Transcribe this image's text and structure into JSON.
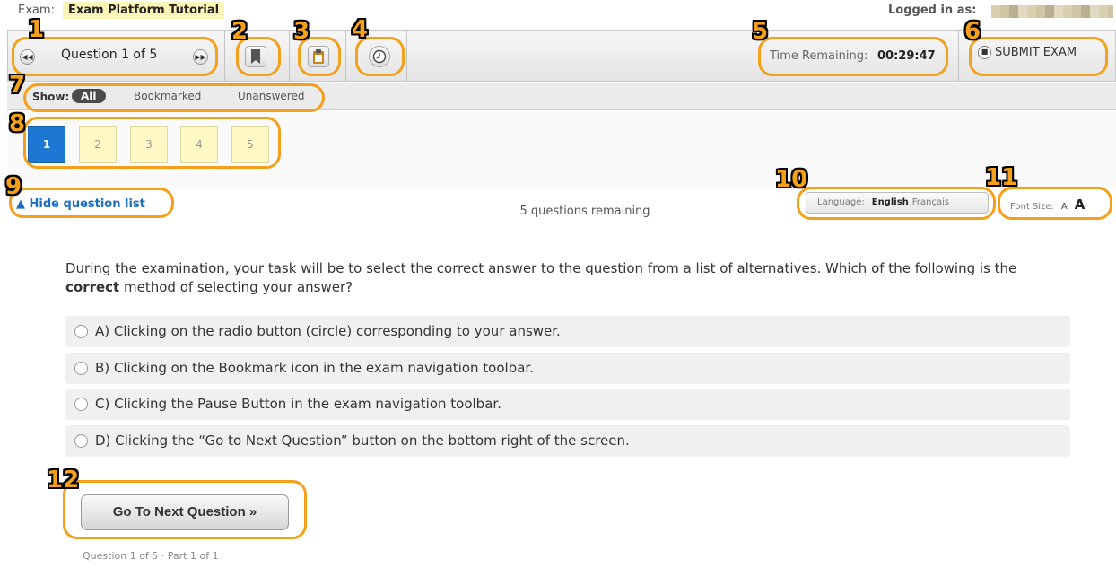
{
  "header": {
    "exam_label": "Exam:",
    "exam_name": "Exam Platform Tutorial",
    "logged_in_label": "Logged in as:"
  },
  "toolbar": {
    "question_counter": "Question 1 of 5",
    "prev_icon": "rewind-icon",
    "next_icon": "fast-forward-icon",
    "bookmark_icon": "bookmark-icon",
    "review_icon": "clipboard-icon",
    "pause_icon": "clock-icon",
    "time_label": "Time Remaining:",
    "time_value": "00:29:47",
    "submit_label": "SUBMIT EXAM"
  },
  "filter": {
    "label": "Show:",
    "options": [
      "All",
      "Bookmarked",
      "Unanswered"
    ],
    "selected": "All"
  },
  "questions": {
    "items": [
      "1",
      "2",
      "3",
      "4",
      "5"
    ],
    "current": "1"
  },
  "list_toggle": "Hide question list",
  "remaining": "5 questions remaining",
  "language": {
    "label": "Language:",
    "options": [
      "English",
      "Français"
    ],
    "selected": "English"
  },
  "font_size": {
    "label": "Font Size:",
    "small": "A",
    "large": "A"
  },
  "question": {
    "text_before": "During the examination, your task will be to select the correct answer to the question from a list of alternatives. Which of the following is the ",
    "text_bold": "correct",
    "text_after": " method of selecting your answer?",
    "answers": [
      "A) Clicking on the radio button (circle) corresponding to your answer.",
      "B) Clicking on the Bookmark icon in the exam navigation toolbar.",
      "C) Clicking the Pause Button in the exam navigation toolbar.",
      "D) Clicking the “Go to Next Question” button on the bottom right of the screen."
    ]
  },
  "next_button": "Go To Next Question »",
  "footer": "Question 1 of 5 · Part 1 of 1",
  "callouts": [
    "1",
    "2",
    "3",
    "4",
    "5",
    "6",
    "7",
    "8",
    "9",
    "10",
    "11",
    "12"
  ],
  "colors": {
    "accent": "#f5a01a",
    "current_question": "#1c78d3",
    "pending_question": "#fdf8c4",
    "link": "#1a6fc4"
  }
}
